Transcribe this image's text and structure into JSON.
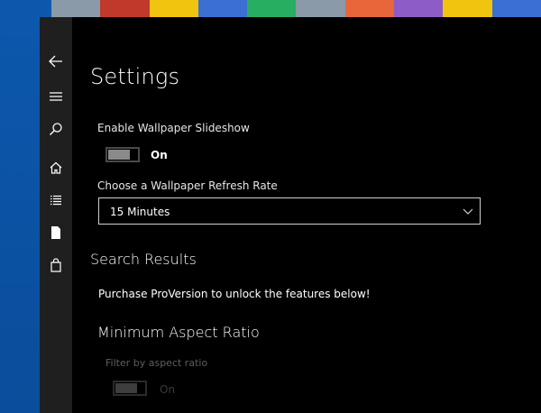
{
  "desktop": {
    "tile_colors": [
      "#8a9aa8",
      "#c0392b",
      "#f1c40f",
      "#3b6fd1",
      "#27ae60",
      "#8a9aa8",
      "#e8663a",
      "#8e5cc7",
      "#f1c40f",
      "#3b6fd1"
    ]
  },
  "nav": {
    "items": [
      {
        "name": "back",
        "icon": "back-arrow-icon"
      },
      {
        "name": "menu",
        "icon": "hamburger-icon"
      },
      {
        "name": "search",
        "icon": "search-icon"
      },
      {
        "name": "home",
        "icon": "home-icon"
      },
      {
        "name": "list",
        "icon": "list-icon"
      },
      {
        "name": "document",
        "icon": "document-icon"
      },
      {
        "name": "shop",
        "icon": "shopping-bag-icon"
      }
    ]
  },
  "settings": {
    "title": "Settings",
    "slideshow_label": "Enable Wallpaper Slideshow",
    "slideshow_state": "On",
    "refresh_label": "Choose a Wallpaper Refresh Rate",
    "refresh_value": "15 Minutes"
  },
  "search_results": {
    "title": "Search Results",
    "promo": "Purchase ProVersion to unlock the features below!",
    "min_aspect_title": "Minimum Aspect Ratio",
    "filter_label": "Filter by aspect ratio",
    "filter_state": "On"
  }
}
